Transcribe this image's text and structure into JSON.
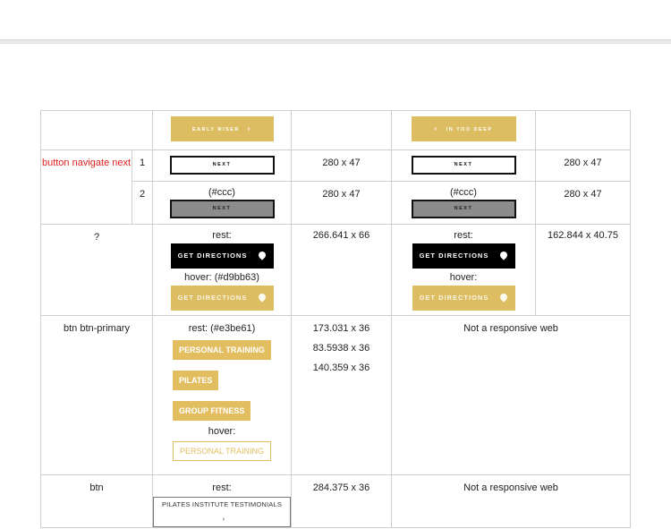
{
  "header_row": {
    "btn_left_label": "EARLY RISER",
    "btn_left_icon": "chevron-right-icon",
    "btn_right_label": "IN TOO DEEP",
    "btn_right_icon": "chevron-left-icon"
  },
  "nav_row": {
    "row_label": "button navigate next",
    "sub1": "1",
    "sub2": "2",
    "next_label": "NEXT",
    "size_left_1": "280 x 47",
    "size_right_1": "280 x 47",
    "color_note": "(#ccc)",
    "size_left_2": "280 x 47",
    "size_right_2": "280 x 47"
  },
  "directions_row": {
    "row_label": "?",
    "rest_label": "rest:",
    "hover_label_left": "hover: (#d9bb63)",
    "hover_label_right": "hover:",
    "button_label": "GET DIRECTIONS",
    "icon": "map-pin-icon",
    "size_left": "266.641 x 66",
    "size_right": "162.844 x 40.75"
  },
  "primary_row": {
    "row_label": "btn btn-primary",
    "rest_label": "rest: (#e3be61)",
    "buttons": [
      "PERSONAL TRAINING",
      "PILATES",
      "GROUP FITNESS"
    ],
    "hover_label": "hover:",
    "hover_button": "PERSONAL TRAINING",
    "sizes": [
      "173.031 x 36",
      "83.5938 x 36",
      "140.359 x 36"
    ],
    "note": "Not a responsive web"
  },
  "btn_row": {
    "row_label": "btn",
    "rest_label": "rest:",
    "button_label": "PILATES INSTITUTE TESTIMONIALS",
    "size": "284.375 x 36",
    "note": "Not a responsive web"
  },
  "colors": {
    "gold": "#ddbd61",
    "primary": "#e3be61",
    "red_label": "#e02020"
  }
}
